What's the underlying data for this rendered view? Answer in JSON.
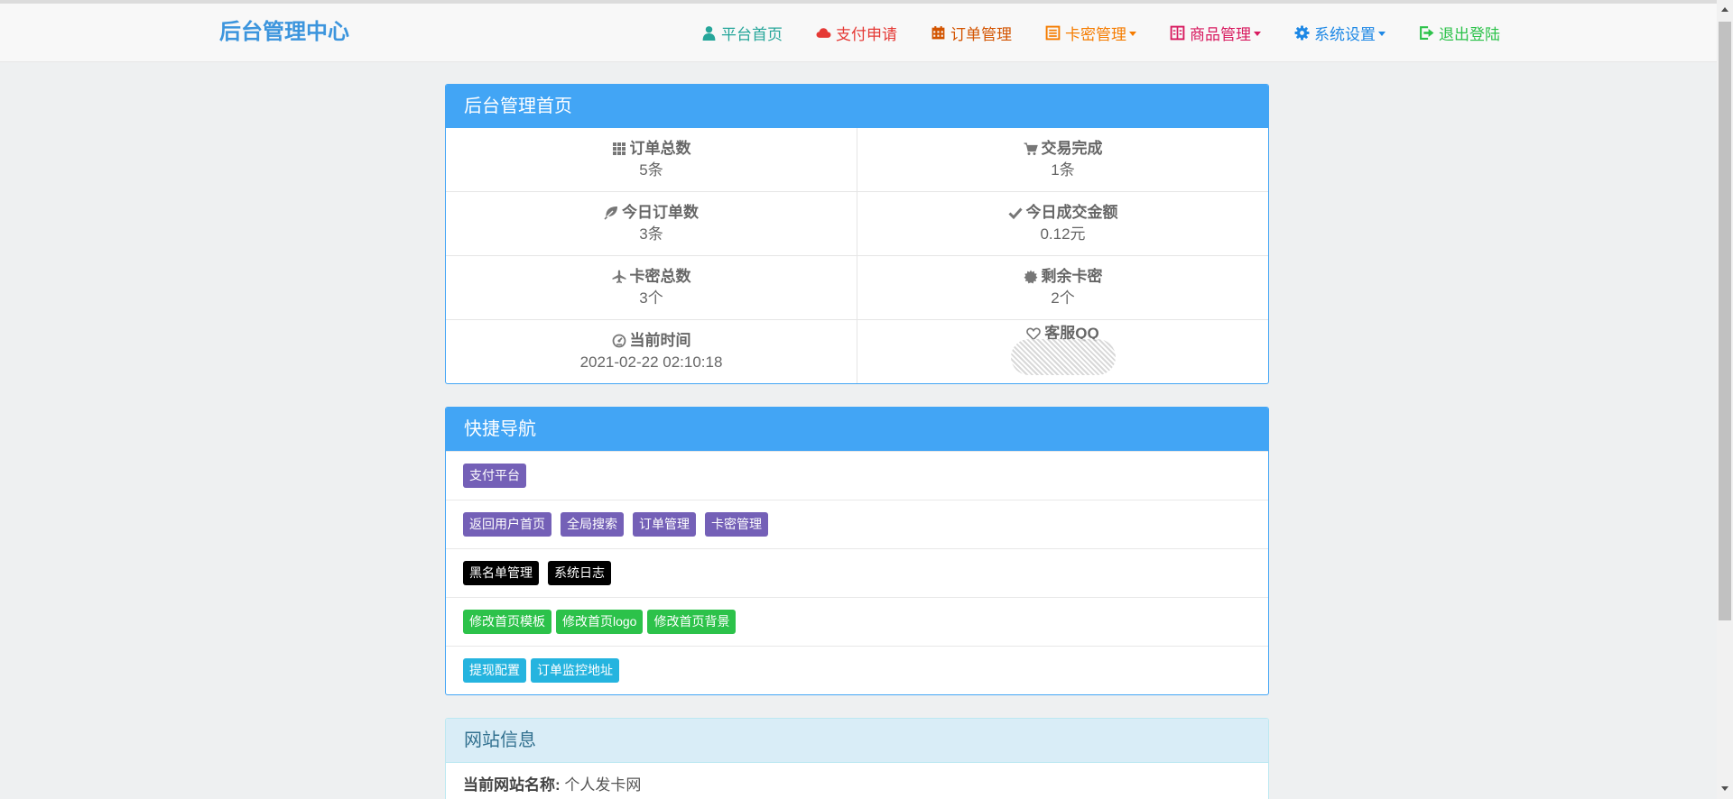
{
  "brand": "后台管理中心",
  "nav": [
    {
      "label": "平台首页",
      "color": "#26a69a",
      "icon": "user-icon"
    },
    {
      "label": "支付申请",
      "color": "#e53935",
      "icon": "cloud-icon"
    },
    {
      "label": "订单管理",
      "color": "#d35400",
      "icon": "calendar-icon"
    },
    {
      "label": "卡密管理",
      "color": "#f57c00",
      "icon": "list-icon",
      "dropdown": true
    },
    {
      "label": "商品管理",
      "color": "#d81b60",
      "icon": "book-icon",
      "dropdown": true
    },
    {
      "label": "系统设置",
      "color": "#1e88e5",
      "icon": "gear-icon",
      "dropdown": true
    },
    {
      "label": "退出登陆",
      "color": "#2cc24a",
      "icon": "logout-icon"
    }
  ],
  "dashboard": {
    "title": "后台管理首页",
    "stats": [
      {
        "label": "订单总数",
        "value": "5条",
        "icon": "th-icon"
      },
      {
        "label": "交易完成",
        "value": "1条",
        "icon": "cart-icon"
      },
      {
        "label": "今日订单数",
        "value": "3条",
        "icon": "leaf-icon"
      },
      {
        "label": "今日成交金额",
        "value": "0.12元",
        "icon": "check-icon"
      },
      {
        "label": "卡密总数",
        "value": "3个",
        "icon": "plane-icon"
      },
      {
        "label": "剩余卡密",
        "value": "2个",
        "icon": "certificate-icon"
      },
      {
        "label": "当前时间",
        "value": "2021-02-22 02:10:18",
        "icon": "dashboard-icon"
      },
      {
        "label": "客服QQ",
        "value": "",
        "icon": "heart-icon"
      }
    ]
  },
  "quicknav": {
    "title": "快捷导航",
    "rows": [
      [
        {
          "label": "支付平台",
          "style": "primary"
        }
      ],
      [
        {
          "label": "返回用户首页",
          "style": "primary"
        },
        {
          "label": "全局搜索",
          "style": "primary"
        },
        {
          "label": "订单管理",
          "style": "primary"
        },
        {
          "label": "卡密管理",
          "style": "primary"
        }
      ],
      [
        {
          "label": "黑名单管理",
          "style": "dark"
        },
        {
          "label": "系统日志",
          "style": "dark"
        }
      ],
      [
        {
          "label": "修改首页模板",
          "style": "success"
        },
        {
          "label": "修改首页logo",
          "style": "success"
        },
        {
          "label": "修改首页背景",
          "style": "success"
        }
      ],
      [
        {
          "label": "提现配置",
          "style": "info"
        },
        {
          "label": "订单监控地址",
          "style": "info"
        }
      ]
    ]
  },
  "siteinfo": {
    "title": "网站信息",
    "name_label": "当前网站名称:",
    "name_value": "个人发卡网"
  }
}
